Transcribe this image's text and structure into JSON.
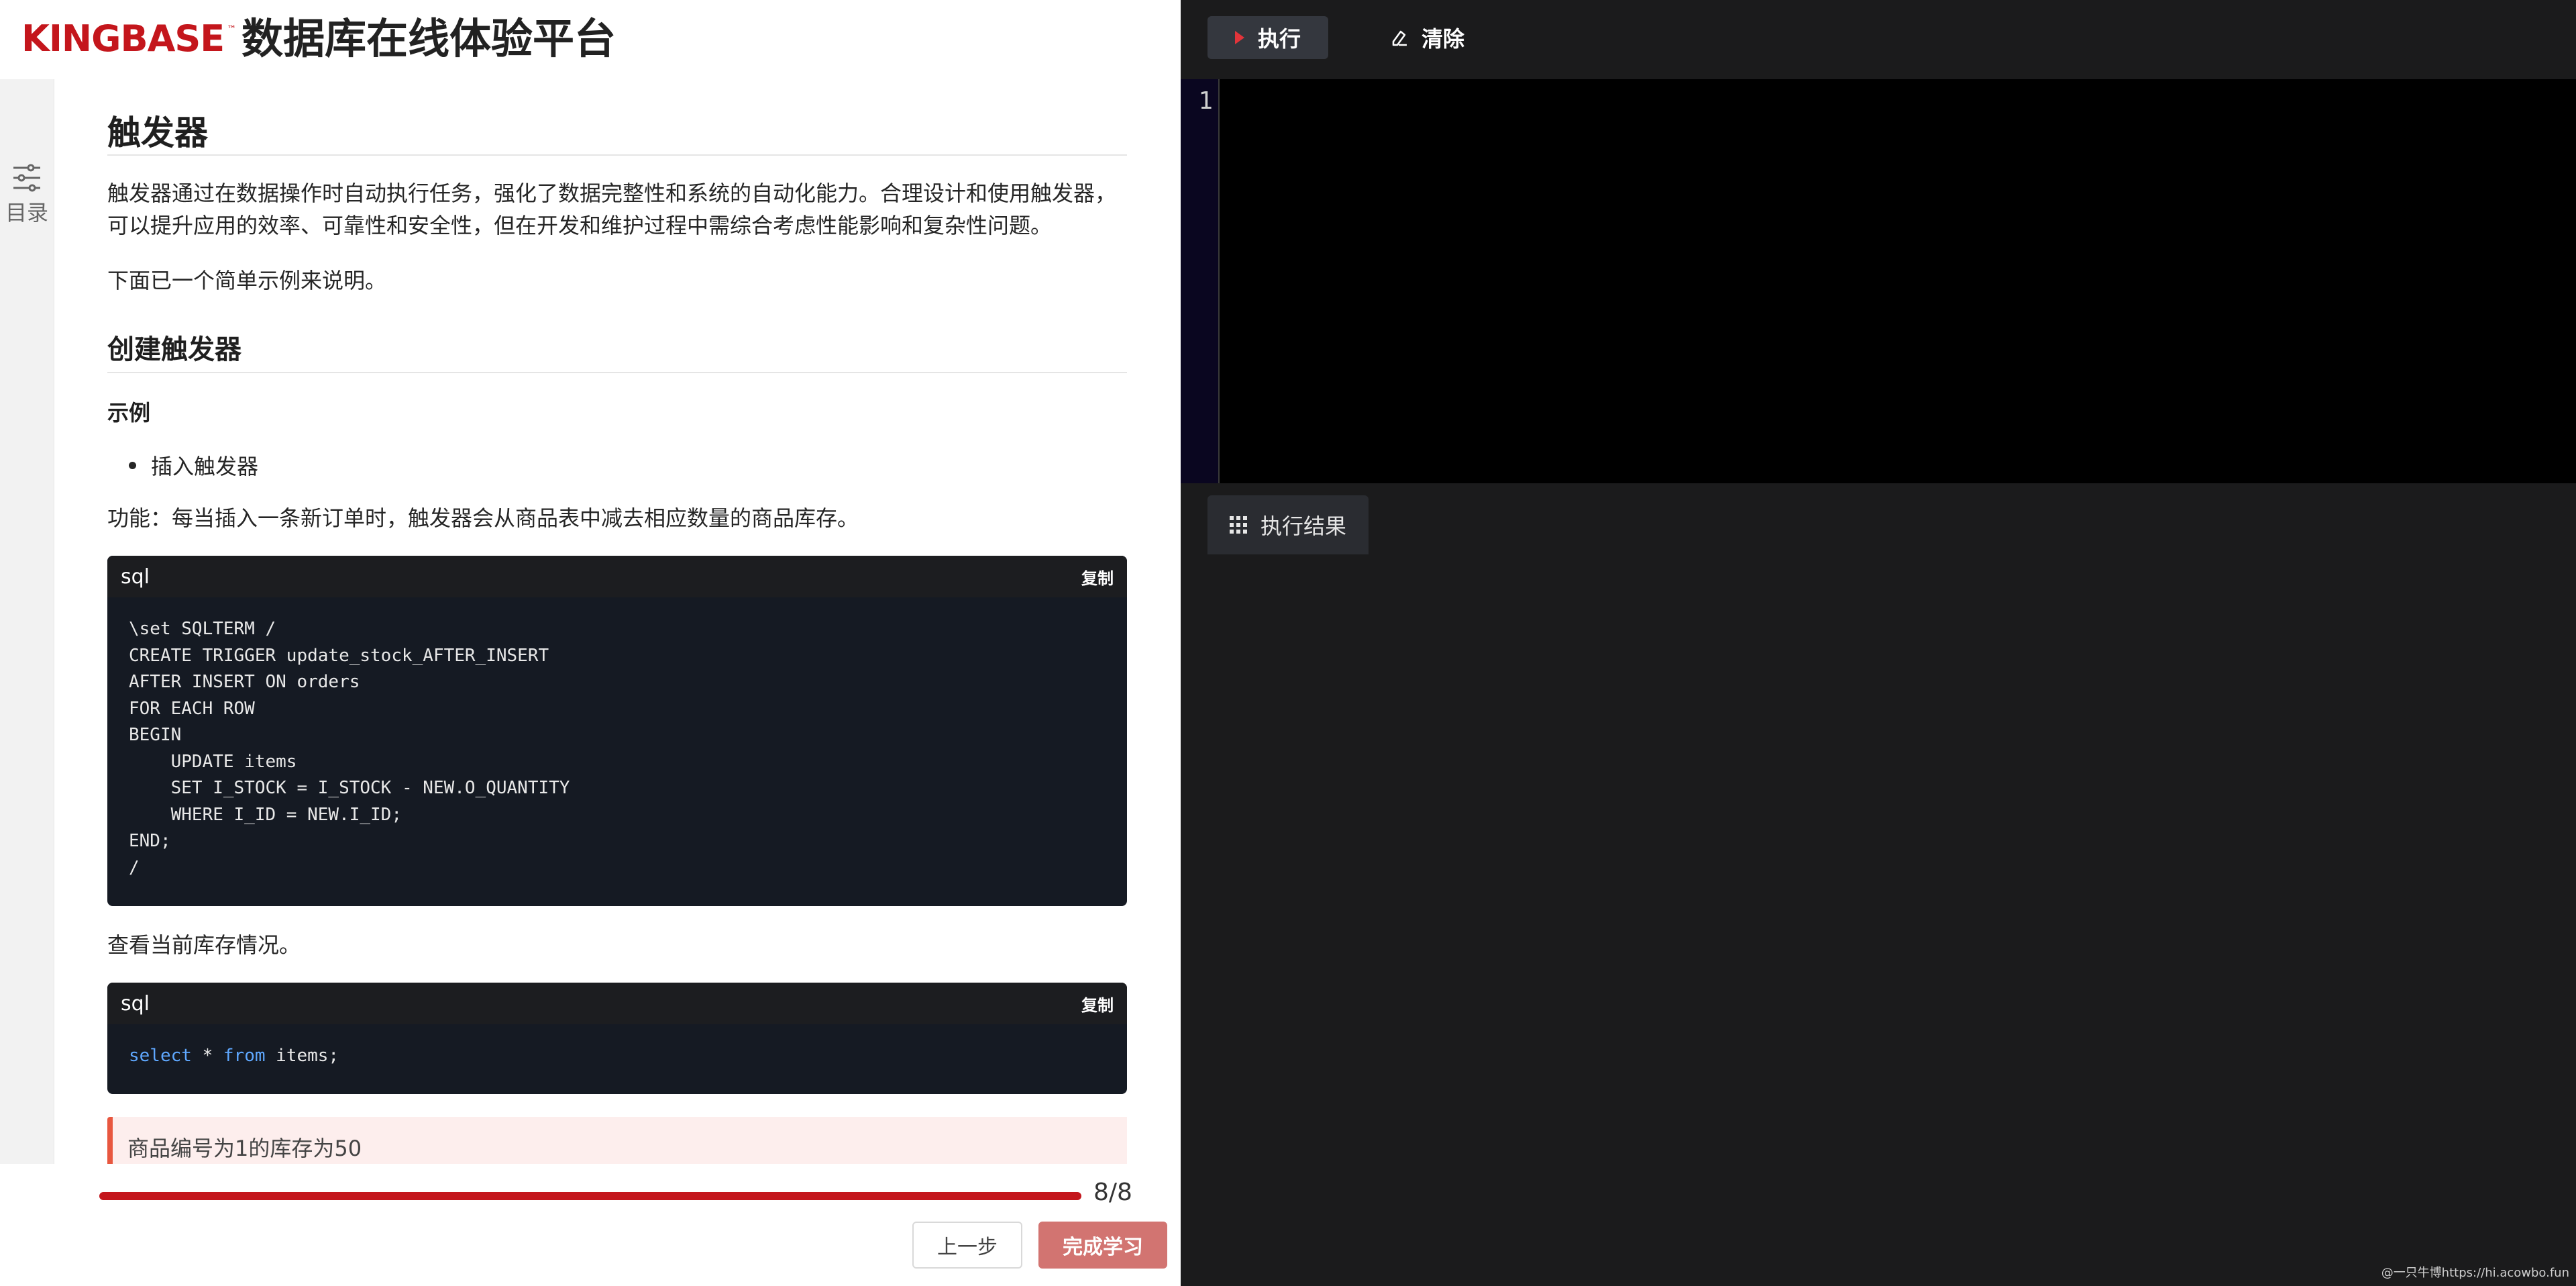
{
  "header": {
    "logo_text": "KINGBASE",
    "logo_tm": "™",
    "title": "数据库在线体验平台"
  },
  "toc": {
    "label": "目录"
  },
  "content": {
    "h1": "触发器",
    "intro_line1": "触发器通过在数据操作时自动执行任务，强化了数据完整性和系统的自动化能力。合理设计和使用触发器，",
    "intro_line2": "可以提升应用的效率、可靠性和安全性，但在开发和维护过程中需综合考虑性能影响和复杂性问题。",
    "example_intro": "下面已一个简单示例来说明。",
    "h2": "创建触发器",
    "h3": "示例",
    "bullet": "插入触发器",
    "function_desc": "功能：每当插入一条新订单时，触发器会从商品表中减去相应数量的商品库存。",
    "code1": {
      "lang": "sql",
      "copy_label": "复制",
      "code": "\\set SQLTERM /\nCREATE TRIGGER update_stock_AFTER_INSERT\nAFTER INSERT ON orders\nFOR EACH ROW\nBEGIN\n    UPDATE items\n    SET I_STOCK = I_STOCK - NEW.O_QUANTITY\n    WHERE I_ID = NEW.I_ID;\nEND;\n/"
    },
    "check_stock": "查看当前库存情况。",
    "code2": {
      "lang": "sql",
      "copy_label": "复制",
      "kw1": "select",
      "mid": " * ",
      "kw2": "from",
      "rest": " items;"
    },
    "note": "商品编号为1的库存为50"
  },
  "footer": {
    "progress_text": "8/8",
    "progress_fraction": 1.0,
    "prev_label": "上一步",
    "finish_label": "完成学习"
  },
  "editor": {
    "run_label": "执行",
    "clear_label": "清除",
    "line_number": "1",
    "results_tab": "执行结果"
  },
  "watermark": "@一只牛博https://hi.acowbo.fun",
  "colors": {
    "brand": "#c4161c",
    "finish_button": "#d27471",
    "run_icon": "#e2343a",
    "keyword": "#5fa8ff"
  }
}
